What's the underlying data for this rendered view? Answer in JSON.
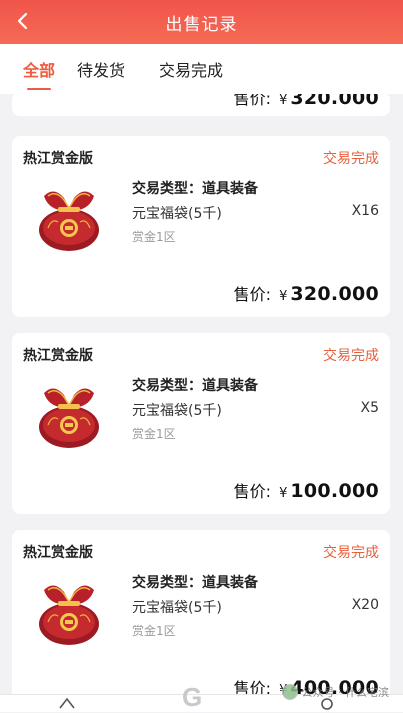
{
  "header": {
    "title": "出售记录"
  },
  "tabs": [
    {
      "label": "全部",
      "active": true
    },
    {
      "label": "待发货",
      "active": false
    },
    {
      "label": "交易完成",
      "active": false
    }
  ],
  "records": [
    {
      "partial": true,
      "price_label": "售价:",
      "currency": "¥",
      "price": "320.000"
    },
    {
      "game": "热江赏金版",
      "status": "交易完成",
      "type_line": "交易类型：道具装备",
      "item": "元宝福袋(5千)",
      "qty": "X16",
      "server": "赏金1区",
      "price_label": "售价:",
      "currency": "¥",
      "price": "320.000"
    },
    {
      "game": "热江赏金版",
      "status": "交易完成",
      "type_line": "交易类型：道具装备",
      "item": "元宝福袋(5千)",
      "qty": "X5",
      "server": "赏金1区",
      "price_label": "售价:",
      "currency": "¥",
      "price": "100.000"
    },
    {
      "game": "热江赏金版",
      "status": "交易完成",
      "type_line": "交易类型：道具装备",
      "item": "元宝福袋(5千)",
      "qty": "X20",
      "server": "赏金1区",
      "price_label": "售价:",
      "currency": "¥",
      "price": "400.000"
    }
  ],
  "icons": {
    "back": "chevron-left-icon",
    "item": "lucky-bag-icon"
  },
  "colors": {
    "header": "#f0554a",
    "accent": "#ef5b3f",
    "status": "#e8603b"
  },
  "watermark": {
    "text": "公众号 · 什么宅滨"
  },
  "logo_letter": "G"
}
